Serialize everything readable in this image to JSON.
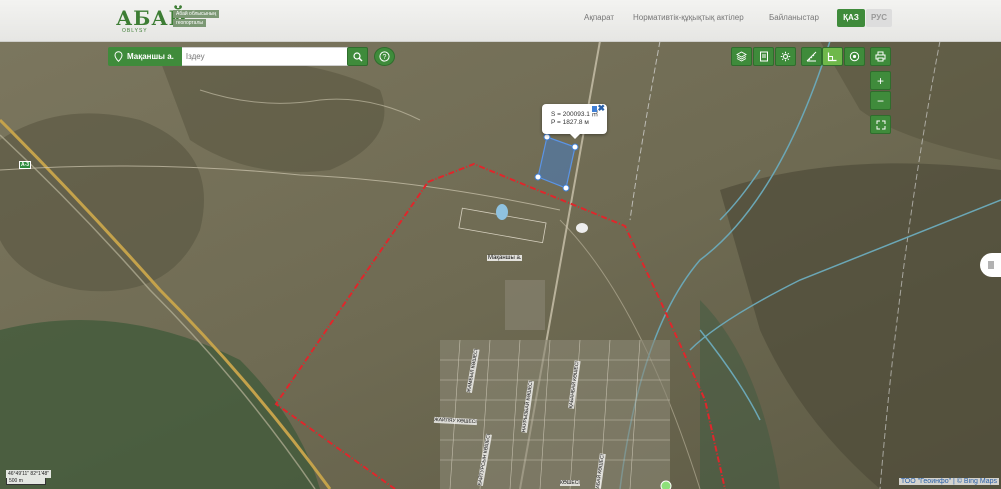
{
  "header": {
    "logo_word": "АБАЙ",
    "logo_sub": "OBLYSY",
    "logo_tags": [
      "Абай облысының",
      "геопорталы"
    ],
    "nav": [
      "Ақпарат",
      "Нормативтік-құқықтық актілер",
      "Байланыстар"
    ],
    "lang_active": "ҚАЗ",
    "lang_inactive": "РУС"
  },
  "search": {
    "location_label": "Мақаншы а.",
    "placeholder": "Іздеу"
  },
  "toolbar": {
    "buttons": [
      "layers-icon",
      "document-icon",
      "settings-icon",
      "measure-length-icon",
      "measure-area-icon",
      "locate-icon",
      "print-icon"
    ],
    "active": "measure-area-icon"
  },
  "zoom": {
    "in": "+",
    "out": "−"
  },
  "popup": {
    "area": "S = 200093.1 ㎡",
    "perimeter": "P = 1827.8 м"
  },
  "map": {
    "village_label": "Мақаншы а.",
    "road_shield": "A-3",
    "streets": [
      "ЖАМБЫЛ КӨШЕСІ",
      "НАУРЫЗБАЙ КӨШЕСІ",
      "ЖАЙЛЯУ КӨШЕСІ",
      "БАЙТУРСЫН КӨШЕСІ",
      "ҚАБАНБАЙ КӨШЕСІ",
      "АБАЙ КӨШЕСІ",
      "КӨШЕСІ"
    ],
    "coordinates": "46°49'11\" 82°1'48\"",
    "scale": "500 m",
    "attribution": "ТОО \"Геоинфо\" | © Bing Maps"
  },
  "colors": {
    "brand_green": "#3f8b3b",
    "boundary_red": "#e0262b",
    "polygon_blue": "#3f7fd6"
  }
}
